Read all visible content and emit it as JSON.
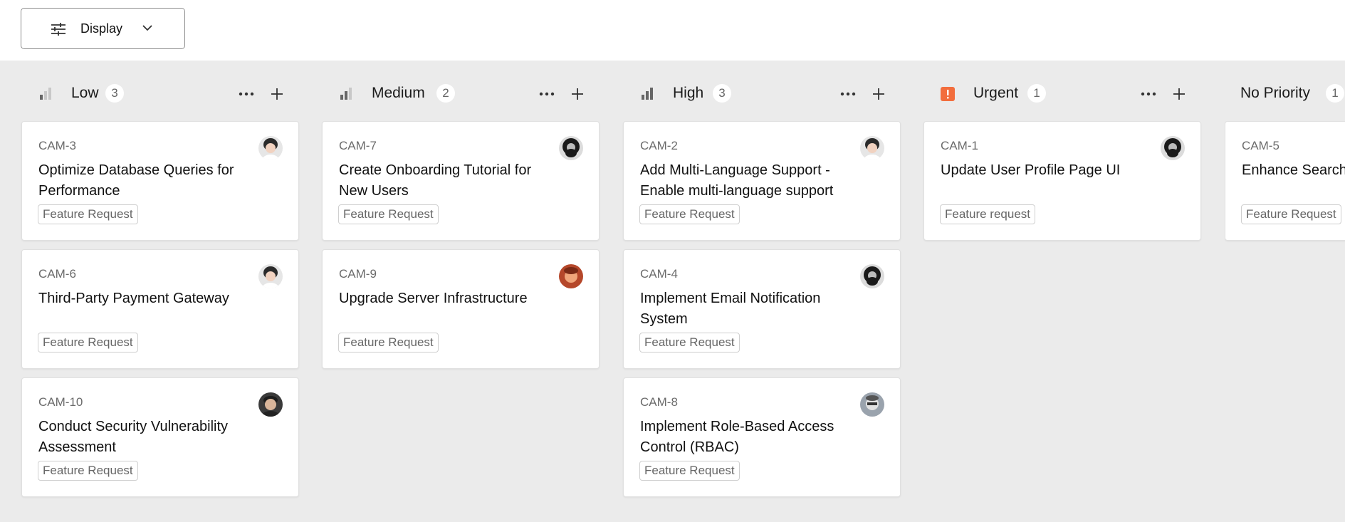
{
  "toolbar": {
    "display_label": "Display",
    "icons": {
      "settings": "sliders-icon",
      "dropdown": "chevron-down-icon"
    }
  },
  "colors": {
    "board_bg": "#ebebeb",
    "card_bg": "#ffffff",
    "urgent_accent": "#f26d3d",
    "priority_bar_active": "#666666",
    "priority_bar_inactive": "#c8c8c8"
  },
  "columns": [
    {
      "title": "Low",
      "count": "3",
      "icon": "priority-low-icon",
      "cards": [
        {
          "id": "CAM-3",
          "title": "Optimize Database Queries for Performance",
          "tag": "Feature Request",
          "avatar": "avatar-woman-curly"
        },
        {
          "id": "CAM-6",
          "title": "Third-Party Payment Gateway",
          "tag": "Feature Request",
          "avatar": "avatar-woman-curly"
        },
        {
          "id": "CAM-10",
          "title": "Conduct Security Vulnerability Assessment",
          "tag": "Feature Request",
          "avatar": "avatar-man-dark"
        }
      ]
    },
    {
      "title": "Medium",
      "count": "2",
      "icon": "priority-medium-icon",
      "cards": [
        {
          "id": "CAM-7",
          "title": "Create Onboarding Tutorial for New Users",
          "tag": "Feature Request",
          "avatar": "avatar-man-beard-bw"
        },
        {
          "id": "CAM-9",
          "title": "Upgrade Server Infrastructure",
          "tag": "Feature Request",
          "avatar": "avatar-man-red"
        }
      ]
    },
    {
      "title": "High",
      "count": "3",
      "icon": "priority-high-icon",
      "cards": [
        {
          "id": "CAM-2",
          "title": "Add Multi-Language Support - Enable multi-language support",
          "tag": "Feature Request",
          "avatar": "avatar-woman-curly"
        },
        {
          "id": "CAM-4",
          "title": "Implement Email Notification System",
          "tag": "Feature Request",
          "avatar": "avatar-man-beard-bw"
        },
        {
          "id": "CAM-8",
          "title": "Implement Role-Based Access Control (RBAC)",
          "tag": "Feature Request",
          "avatar": "avatar-man-glasses"
        }
      ]
    },
    {
      "title": "Urgent",
      "count": "1",
      "icon": "urgent-icon",
      "cards": [
        {
          "id": "CAM-1",
          "title": "Update User Profile Page UI",
          "tag": "Feature request",
          "avatar": "avatar-man-beard-bw"
        }
      ]
    },
    {
      "title": "No Priority",
      "count": "1",
      "icon": "",
      "cards": [
        {
          "id": "CAM-5",
          "title": "Enhance Search",
          "tag": "Feature Request",
          "avatar": ""
        }
      ]
    }
  ]
}
